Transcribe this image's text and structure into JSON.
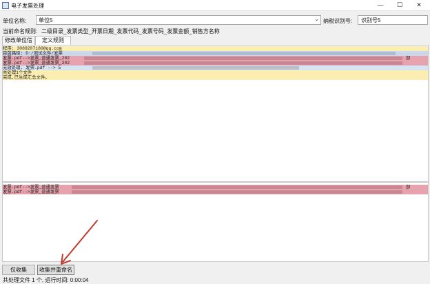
{
  "window": {
    "title": "电子发票处理",
    "minimize_glyph": "—",
    "maximize_glyph": "☐",
    "close_glyph": "✕"
  },
  "unit": {
    "label": "单位名称:",
    "value": "单位5",
    "taxid_label": "纳税识别号:",
    "taxid_value": "识别号5"
  },
  "naming_rule": {
    "label": "当前命名规则:",
    "value": "二级目录_发票类型_开票日期_发票代码_发票号码_发票金额_销售方名称"
  },
  "tabs": [
    "修改单位信息",
    "定义规则"
  ],
  "log": {
    "lines": [
      {
        "text": "程序: 3089287180@qq.com",
        "color": "yellow"
      },
      {
        "text": "目前路径: D:/测试文件/发票",
        "color": "blue"
      },
      {
        "text": "发票.pdf-->发票_普通发票_202",
        "color": "pink",
        "tail": "部"
      },
      {
        "text": "发票.pdf-->发票_普通发票_202",
        "color": "pink"
      },
      {
        "text": "  无效处理. 发票.pdf --> 5",
        "color": "blue2"
      },
      {
        "text": "共处理1个文件",
        "color": "yellow"
      },
      {
        "text": "完成,已生成汇总文件。",
        "color": "yellow"
      }
    ]
  },
  "results": {
    "lines": [
      {
        "text": "发票.pdf-->发票_普通发票",
        "tail": "部"
      },
      {
        "text": "发票.pdf-->发票_普通发票",
        "tail": ""
      }
    ]
  },
  "buttons": {
    "collect": "仅收集",
    "collect_rename": "收集并重命名"
  },
  "status": "共处理文件 1 个, 运行时间: 0:00:04",
  "colors": {
    "annotation_arrow": "#c0392b",
    "log_yellow": "#fbeeb0",
    "log_pink": "#e6a3ad",
    "log_blue": "#c9d8ea"
  }
}
